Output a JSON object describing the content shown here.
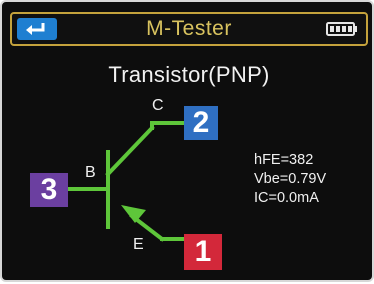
{
  "header": {
    "title": "M-Tester",
    "back_icon": "return-arrow-icon",
    "battery_icon": "battery-full-icon"
  },
  "screen": {
    "title": "Transistor(PNP)"
  },
  "pins": {
    "collector": {
      "label": "C",
      "number": "2",
      "color": "#2f6fc2"
    },
    "base": {
      "label": "B",
      "number": "3",
      "color": "#6b3fa0"
    },
    "emitter": {
      "label": "E",
      "number": "1",
      "color": "#d3283a"
    }
  },
  "readings": {
    "hfe": "hFE=382",
    "vbe": "Vbe=0.79V",
    "ic": "IC=0.0mA"
  },
  "colors": {
    "symbol": "#5ec63a",
    "header_border": "#c4a23c",
    "title_text": "#d9c35f",
    "back_button": "#1f7fd1"
  }
}
